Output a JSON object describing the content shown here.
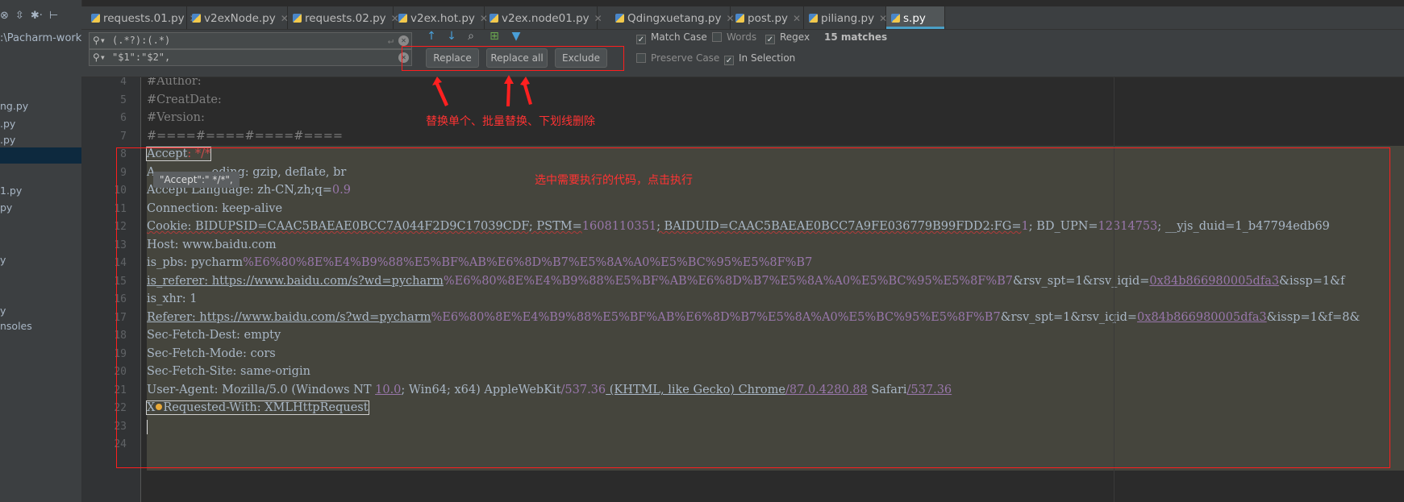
{
  "sidebar": {
    "toolbar_icons": [
      "settings-icon",
      "collapse-icon",
      "gear-icon",
      "pin-icon"
    ],
    "path": ":\\Pacharm-work",
    "items": [
      "ng.py",
      ".py",
      ".py",
      "1.py",
      "py",
      "y",
      "y",
      "nsoles"
    ]
  },
  "tabs": [
    {
      "label": "requests.01.py"
    },
    {
      "label": "v2exNode.py"
    },
    {
      "label": "requests.02.py"
    },
    {
      "label": "v2ex.hot.py"
    },
    {
      "label": "v2ex.node01.py"
    },
    {
      "label": "Qdingxuetang.py"
    },
    {
      "label": "post.py"
    },
    {
      "label": "piliang.py"
    },
    {
      "label": "s.py"
    }
  ],
  "find": {
    "search_value": "(.*?):(.*)",
    "replace_value": "\"$1\":\"$2\",",
    "replace_label": "Replace",
    "replace_all_label": "Replace all",
    "exclude_label": "Exclude",
    "match_case_label": "Match Case",
    "match_case": true,
    "words_label": "Words",
    "words": false,
    "regex_label": "Regex",
    "regex": true,
    "matches": "15 matches",
    "preserve_case_label": "Preserve Case",
    "preserve_case": false,
    "in_selection_label": "In Selection",
    "in_selection": true
  },
  "editor": {
    "line_numbers": [
      "4",
      "5",
      "6",
      "7",
      "8",
      "9",
      "10",
      "11",
      "12",
      "13",
      "14",
      "15",
      "16",
      "17",
      "18",
      "19",
      "20",
      "21",
      "22",
      "23",
      "24"
    ],
    "tooltip": "\"Accept\":\" */*\",",
    "lines": {
      "l4": "#Author:",
      "l5": "#CreatDate:",
      "l6": "#Version:",
      "l7": "#====#====#====#====",
      "l8_key": "Accept",
      "l8_val": ": */*",
      "l9_a": "A",
      "l9_b": "oding: gzip, deflate, br",
      "l10_a": "Accept",
      "l10_b": "Language: zh-CN,zh;q=",
      "l10_c": "0.9",
      "l11": "Connection: keep-alive",
      "l12_a": "Cookie: BIDUPSID=CAAC5BAEAE0BCC7A044F2D9C17039CDF; PSTM=",
      "l12_b": "1608110351",
      "l12_c": "; BAIDUID=CAAC5BAEAE0BCC7A9FE036779B99FDD2:FG=",
      "l12_d": "1",
      "l12_e": "; BD_UPN=",
      "l12_f": "12314753",
      "l12_g": "; __yjs_duid=1_b47794edb69",
      "l13": "Host: www.baidu.com",
      "l14_a": "is_pbs: pycharm",
      "l14_b": "%E6%80%8E%E4%B9%88%E5%BF%AB%E6%8D%B7%E5%8A%A0%E5%BC%95%E5%8F%B7",
      "l15_a": "is_referer: https://www.baidu.com/s?wd=pycharm",
      "l15_b": "%E6%80%8E%E4%B9%88%E5%BF%AB%E6%8D%B7%E5%8A%A0%E5%BC%95%E5%8F%B7",
      "l15_c": "&rsv_spt=1&rsv_iqid=",
      "l15_d": "0x84b866980005dfa3",
      "l15_e": "&issp=1&f",
      "l16": "is_xhr: 1",
      "l17_a": "Referer: https://www.baidu.com/s?wd=pycharm",
      "l17_b": "%E6%80%8E%E4%B9%88%E5%BF%AB%E6%8D%B7%E5%8A%A0%E5%BC%95%E5%8F%B7",
      "l17_c": "&rsv_spt=1&rsv_iqid=",
      "l17_d": "0x84b866980005dfa3",
      "l17_e": "&issp=1&f=8&",
      "l18": "Sec-Fetch-Dest: empty",
      "l19": "Sec-Fetch-Mode: cors",
      "l20": "Sec-Fetch-Site: same-origin",
      "l21_a": "User-Agent: Mozilla/5.0 (Windows NT ",
      "l21_b": "10.0",
      "l21_c": "; Win64; x64) AppleWebKit",
      "l21_d": "/537.36",
      "l21_e": " (KHTML, like Gecko) Chrome",
      "l21_f": "/87.0.4280.88",
      "l21_g": " Safari",
      "l21_h": "/537.36",
      "l22_a": "X",
      "l22_b": "Requested-With: XMLHttpRequest"
    }
  },
  "annotations": {
    "buttons_note": "替换单个、批量替换、下划线删除",
    "selection_note": "选中需要执行的代码，点击执行"
  },
  "colors": {
    "annotation": "#ff1e1e",
    "active_tab_accent": "#4a9fc6",
    "selection": "#45453d"
  }
}
